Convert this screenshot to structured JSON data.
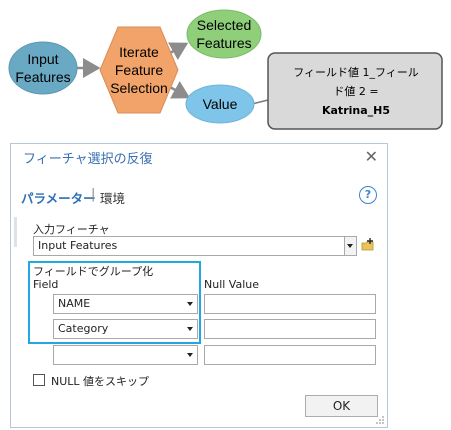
{
  "diagram": {
    "input_label": "Input\nFeatures",
    "iterate_label": "Iterate\nFeature\nSelection",
    "selected_label": "Selected\nFeatures",
    "value_label": "Value",
    "callout_line1": "フィールド値 1_フィール",
    "callout_line2": "ド値 2 =",
    "callout_bold": "Katrina_H5",
    "colors": {
      "input_fill": "#6aa9c4",
      "iterate_fill": "#f2a36a",
      "selected_fill": "#8fcf7a",
      "value_fill": "#7fc5ea",
      "callout_fill": "#d9d9d9"
    }
  },
  "dialog": {
    "title": "フィーチャ選択の反復",
    "close_glyph": "✕",
    "tab_parameters": "パラメーター",
    "tab_separator": "|",
    "tab_environments": "環境",
    "help_glyph": "?",
    "input_features_label": "入力フィーチャ",
    "input_features_value": "Input Features",
    "group_by_label": "フィールドでグループ化",
    "field_header": "Field",
    "null_value_header": "Null Value",
    "rows": [
      {
        "field": "NAME",
        "null_value": ""
      },
      {
        "field": "Category",
        "null_value": ""
      },
      {
        "field": "",
        "null_value": ""
      }
    ],
    "skip_null_label": "NULL 値をスキップ",
    "skip_null_checked": false,
    "ok_label": "OK"
  }
}
